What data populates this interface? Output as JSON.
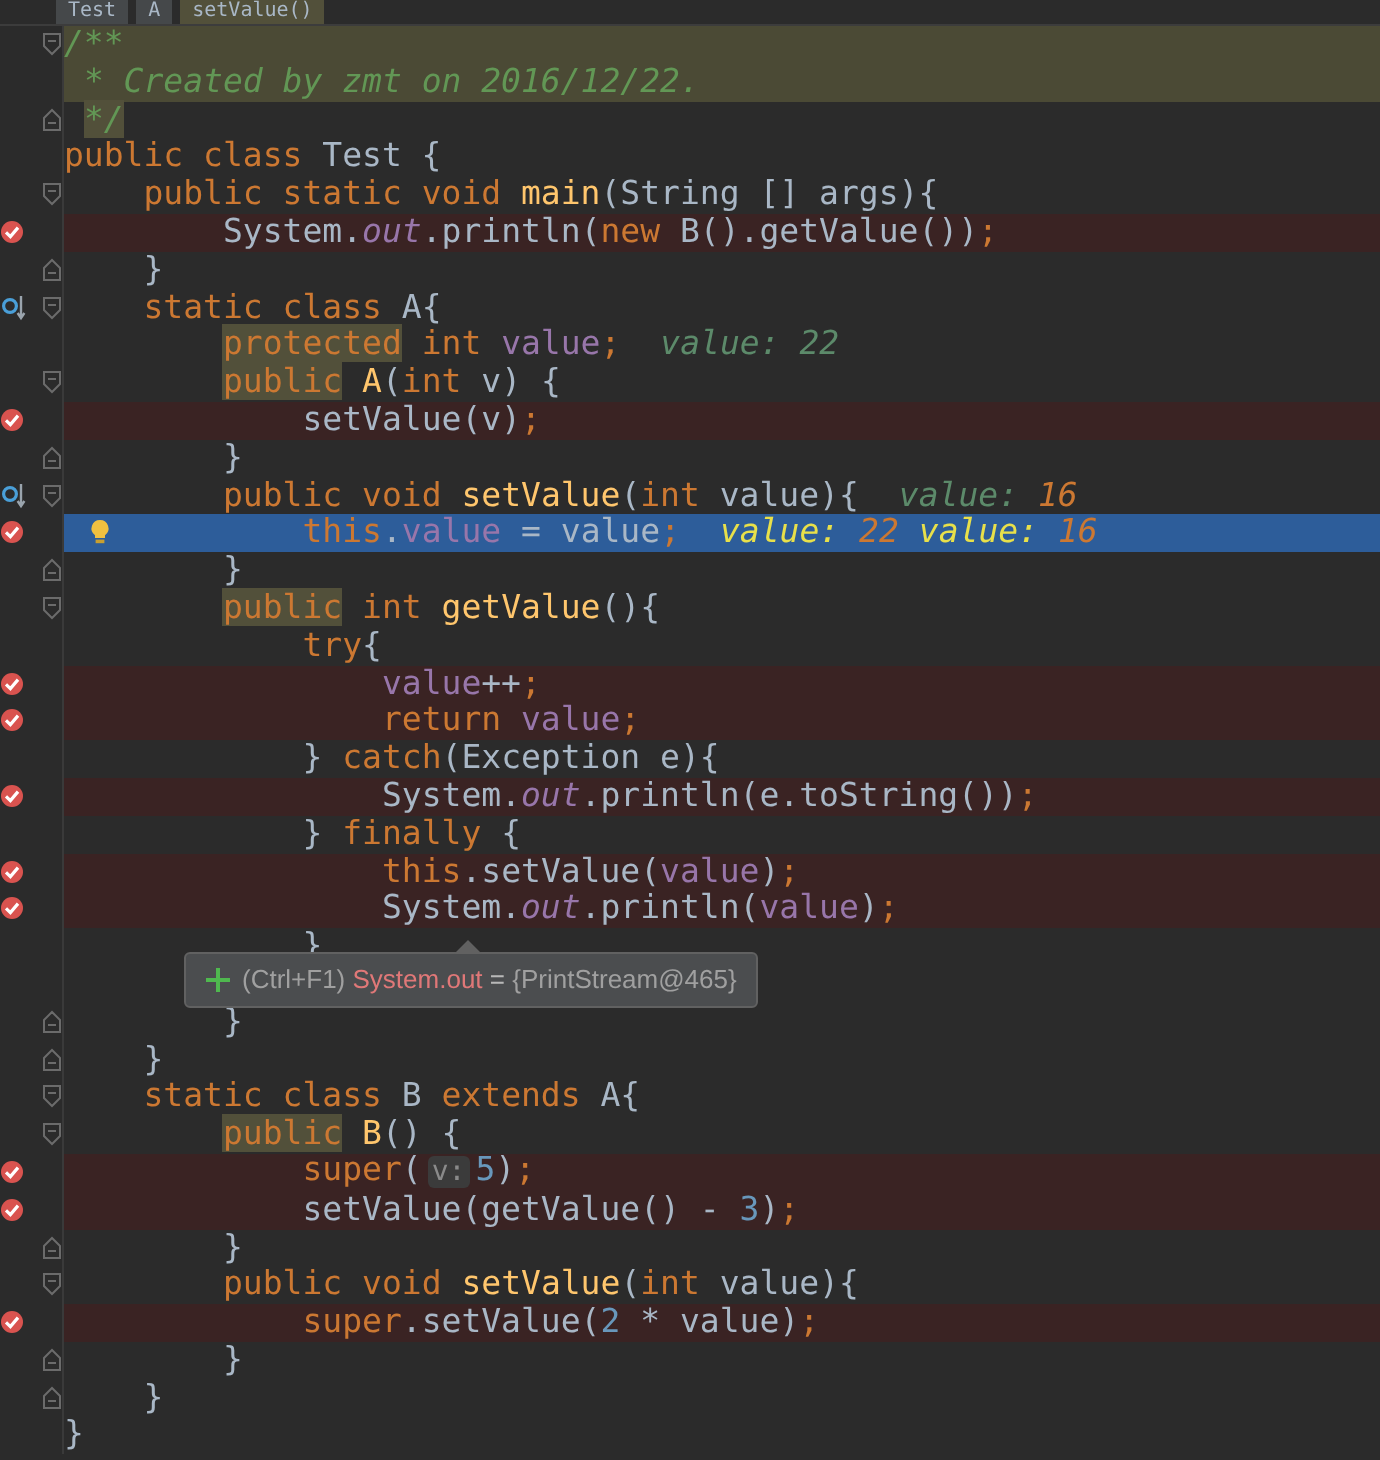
{
  "breadcrumbs": [
    {
      "text": "Test",
      "selected": false
    },
    {
      "text": "A",
      "selected": false
    },
    {
      "text": "setValue()",
      "selected": true
    }
  ],
  "lines": [
    {
      "tokens": [
        {
          "kind": "doc",
          "text": "/**"
        }
      ],
      "range_highlight": true,
      "fold_open": true,
      "breakpoint": false,
      "current": false
    },
    {
      "tokens": [
        {
          "kind": "doc",
          "text": " * Created by zmt on 2016/12/22."
        }
      ],
      "range_highlight": true,
      "breakpoint": false,
      "current": false
    },
    {
      "tokens": [
        {
          "kind": "doc",
          "text": " */",
          "highlighted": true
        }
      ],
      "fold_close": true,
      "breakpoint": false,
      "current": false
    },
    {
      "tokens": [
        {
          "kind": "kw",
          "text": "public class "
        },
        {
          "kind": "plain",
          "text": "Test {"
        }
      ],
      "breakpoint": false,
      "current": false
    },
    {
      "tokens": [
        {
          "kind": "kw",
          "text": "    public static void "
        },
        {
          "kind": "decl",
          "text": "main"
        },
        {
          "kind": "plain",
          "text": "(String [] args){"
        }
      ],
      "fold_open": true,
      "breakpoint": false,
      "current": false
    },
    {
      "tokens": [
        {
          "kind": "plain",
          "text": "        System."
        },
        {
          "kind": "static",
          "text": "out"
        },
        {
          "kind": "plain",
          "text": ".println("
        },
        {
          "kind": "kw",
          "text": "new "
        },
        {
          "kind": "plain",
          "text": "B().getValue())"
        },
        {
          "kind": "kw",
          "text": ";"
        }
      ],
      "breakpoint": true,
      "current": false
    },
    {
      "tokens": [
        {
          "kind": "plain",
          "text": "    }"
        }
      ],
      "fold_close": true,
      "breakpoint": false,
      "current": false
    },
    {
      "tokens": [
        {
          "kind": "kw",
          "text": "    static class "
        },
        {
          "kind": "plain",
          "text": "A{"
        }
      ],
      "step_marker": true,
      "fold_open": true,
      "breakpoint": false,
      "current": false
    },
    {
      "tokens": [
        {
          "kind": "kw",
          "text": "        protected",
          "highlighted": true
        },
        {
          "kind": "kw",
          "text": " int "
        },
        {
          "kind": "field",
          "text": "value"
        },
        {
          "kind": "kw",
          "text": ";"
        }
      ],
      "inline_values": [
        {
          "name": "value:",
          "value": "22",
          "muted": true
        }
      ],
      "breakpoint": false,
      "current": false
    },
    {
      "tokens": [
        {
          "kind": "kw",
          "text": "        public",
          "highlighted": true
        },
        {
          "kind": "decl",
          "text": " A"
        },
        {
          "kind": "plain",
          "text": "("
        },
        {
          "kind": "kw",
          "text": "int "
        },
        {
          "kind": "plain",
          "text": "v) {"
        }
      ],
      "fold_open": true,
      "breakpoint": false,
      "current": false
    },
    {
      "tokens": [
        {
          "kind": "plain",
          "text": "            setValue(v)"
        },
        {
          "kind": "kw",
          "text": ";"
        }
      ],
      "breakpoint": true,
      "current": false
    },
    {
      "tokens": [
        {
          "kind": "plain",
          "text": "        }"
        }
      ],
      "fold_close": true,
      "breakpoint": false,
      "current": false
    },
    {
      "tokens": [
        {
          "kind": "kw",
          "text": "        public void "
        },
        {
          "kind": "decl",
          "text": "setValue"
        },
        {
          "kind": "plain",
          "text": "("
        },
        {
          "kind": "kw",
          "text": "int "
        },
        {
          "kind": "plain",
          "text": "value){"
        }
      ],
      "inline_values": [
        {
          "name": "value:",
          "value": "16",
          "muted": false
        }
      ],
      "step_marker": true,
      "fold_open": true,
      "breakpoint": false,
      "current": false
    },
    {
      "tokens": [
        {
          "kind": "kw",
          "text": "            this"
        },
        {
          "kind": "plain",
          "text": "."
        },
        {
          "kind": "field",
          "text": "value"
        },
        {
          "kind": "plain",
          "text": " = value"
        },
        {
          "kind": "kw",
          "text": ";"
        }
      ],
      "inline_values": [
        {
          "name": "value:",
          "value": "22",
          "muted": false
        },
        {
          "name": "value:",
          "value": "16",
          "muted": false
        }
      ],
      "bulb": true,
      "breakpoint": true,
      "current": true
    },
    {
      "tokens": [
        {
          "kind": "plain",
          "text": "        }"
        }
      ],
      "fold_close": true,
      "breakpoint": false,
      "current": false
    },
    {
      "tokens": [
        {
          "kind": "kw",
          "text": "        public",
          "highlighted": true
        },
        {
          "kind": "kw",
          "text": " int "
        },
        {
          "kind": "decl",
          "text": "getValue"
        },
        {
          "kind": "plain",
          "text": "(){"
        }
      ],
      "fold_open": true,
      "breakpoint": false,
      "current": false
    },
    {
      "tokens": [
        {
          "kind": "kw",
          "text": "            try"
        },
        {
          "kind": "plain",
          "text": "{"
        }
      ],
      "breakpoint": false,
      "current": false
    },
    {
      "tokens": [
        {
          "kind": "field",
          "text": "                value"
        },
        {
          "kind": "plain",
          "text": "++"
        },
        {
          "kind": "kw",
          "text": ";"
        }
      ],
      "breakpoint": true,
      "current": false
    },
    {
      "tokens": [
        {
          "kind": "kw",
          "text": "                return "
        },
        {
          "kind": "field",
          "text": "value"
        },
        {
          "kind": "kw",
          "text": ";"
        }
      ],
      "breakpoint": true,
      "current": false
    },
    {
      "tokens": [
        {
          "kind": "plain",
          "text": "            } "
        },
        {
          "kind": "kw",
          "text": "catch"
        },
        {
          "kind": "plain",
          "text": "(Exception e){"
        }
      ],
      "breakpoint": false,
      "current": false
    },
    {
      "tokens": [
        {
          "kind": "plain",
          "text": "                System."
        },
        {
          "kind": "static",
          "text": "out"
        },
        {
          "kind": "plain",
          "text": ".println(e.toString())"
        },
        {
          "kind": "kw",
          "text": ";"
        }
      ],
      "breakpoint": true,
      "current": false
    },
    {
      "tokens": [
        {
          "kind": "plain",
          "text": "            } "
        },
        {
          "kind": "kw",
          "text": "finally"
        },
        {
          "kind": "plain",
          "text": " {"
        }
      ],
      "breakpoint": false,
      "current": false
    },
    {
      "tokens": [
        {
          "kind": "kw",
          "text": "                this"
        },
        {
          "kind": "plain",
          "text": ".setValue("
        },
        {
          "kind": "field",
          "text": "value"
        },
        {
          "kind": "plain",
          "text": ")"
        },
        {
          "kind": "kw",
          "text": ";"
        }
      ],
      "breakpoint": true,
      "current": false
    },
    {
      "tokens": [
        {
          "kind": "plain",
          "text": "                System."
        },
        {
          "kind": "static",
          "text": "out"
        },
        {
          "kind": "plain",
          "text": ".println("
        },
        {
          "kind": "field",
          "text": "value"
        },
        {
          "kind": "plain",
          "text": ")"
        },
        {
          "kind": "kw",
          "text": ";"
        }
      ],
      "breakpoint": true,
      "current": false
    },
    {
      "tokens": [
        {
          "kind": "plain",
          "text": "            }"
        }
      ],
      "breakpoint": false,
      "current": false
    },
    {
      "breakpoint": false,
      "current": false
    },
    {
      "tokens": [
        {
          "kind": "plain",
          "text": "        }"
        }
      ],
      "fold_close": true,
      "breakpoint": false,
      "current": false
    },
    {
      "tokens": [
        {
          "kind": "plain",
          "text": "    }"
        }
      ],
      "fold_close": true,
      "breakpoint": false,
      "current": false
    },
    {
      "tokens": [
        {
          "kind": "kw",
          "text": "    static class "
        },
        {
          "kind": "plain",
          "text": "B "
        },
        {
          "kind": "kw",
          "text": "extends "
        },
        {
          "kind": "plain",
          "text": "A{"
        }
      ],
      "fold_open": true,
      "breakpoint": false,
      "current": false
    },
    {
      "tokens": [
        {
          "kind": "kw",
          "text": "        public",
          "highlighted": true
        },
        {
          "kind": "decl",
          "text": " B"
        },
        {
          "kind": "plain",
          "text": "() {"
        }
      ],
      "fold_open": true,
      "breakpoint": false,
      "current": false
    },
    {
      "tokens": [
        {
          "kind": "kw",
          "text": "            super"
        },
        {
          "kind": "plain",
          "text": "("
        },
        {
          "kind": "hint",
          "text": "v:"
        },
        {
          "kind": "num",
          "text": "5"
        },
        {
          "kind": "plain",
          "text": ")"
        },
        {
          "kind": "kw",
          "text": ";"
        }
      ],
      "breakpoint": true,
      "current": false
    },
    {
      "tokens": [
        {
          "kind": "plain",
          "text": "            setValue(getValue() - "
        },
        {
          "kind": "num",
          "text": "3"
        },
        {
          "kind": "plain",
          "text": ")"
        },
        {
          "kind": "kw",
          "text": ";"
        }
      ],
      "breakpoint": true,
      "current": false
    },
    {
      "tokens": [
        {
          "kind": "plain",
          "text": "        }"
        }
      ],
      "fold_close": true,
      "breakpoint": false,
      "current": false
    },
    {
      "tokens": [
        {
          "kind": "kw",
          "text": "        public void "
        },
        {
          "kind": "decl",
          "text": "setValue"
        },
        {
          "kind": "plain",
          "text": "("
        },
        {
          "kind": "kw",
          "text": "int "
        },
        {
          "kind": "plain",
          "text": "value){"
        }
      ],
      "fold_open": true,
      "breakpoint": false,
      "current": false
    },
    {
      "tokens": [
        {
          "kind": "kw",
          "text": "            super"
        },
        {
          "kind": "plain",
          "text": ".setValue("
        },
        {
          "kind": "num",
          "text": "2"
        },
        {
          "kind": "plain",
          "text": " * value)"
        },
        {
          "kind": "kw",
          "text": ";"
        }
      ],
      "breakpoint": true,
      "current": false
    },
    {
      "tokens": [
        {
          "kind": "plain",
          "text": "        }"
        }
      ],
      "fold_close": true,
      "breakpoint": false,
      "current": false
    },
    {
      "tokens": [
        {
          "kind": "plain",
          "text": "    }"
        }
      ],
      "fold_close": true,
      "breakpoint": false,
      "current": false
    },
    {
      "tokens": [
        {
          "kind": "plain",
          "text": "}"
        }
      ],
      "breakpoint": false,
      "current": false
    }
  ],
  "tooltip": {
    "shortcut": "(Ctrl+F1)",
    "expression": "System.out",
    "operator": "=",
    "value": "{PrintStream@465}"
  }
}
